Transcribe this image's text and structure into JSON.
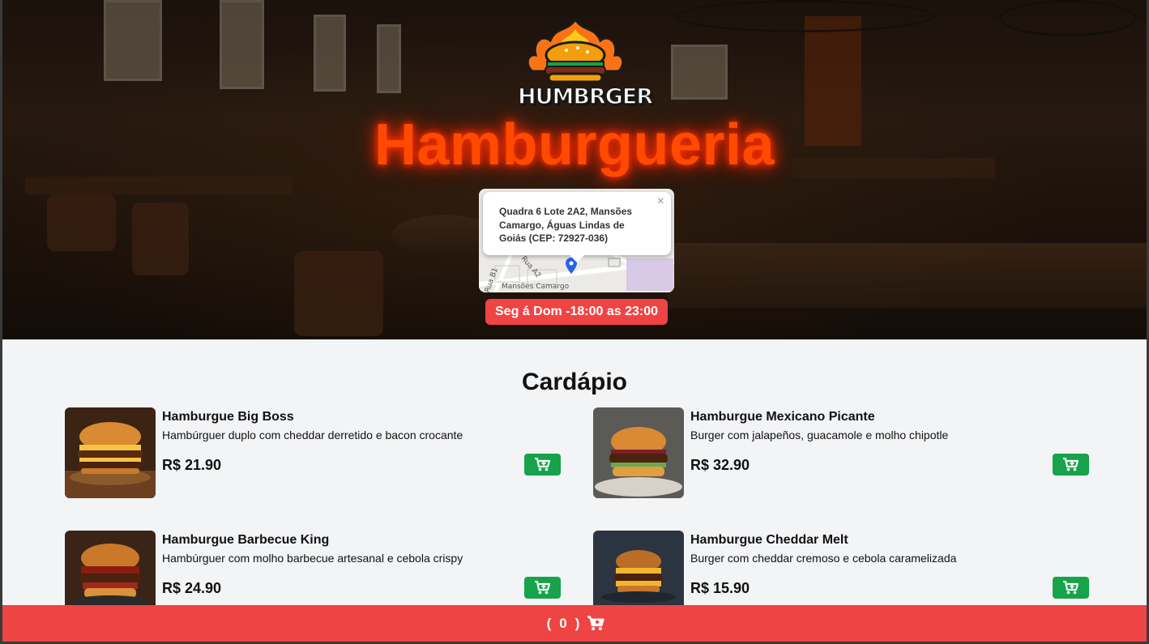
{
  "header": {
    "logo_text": "HUMBRGER",
    "title": "Hamburgueria",
    "map": {
      "address": "Quadra 6 Lote 2A2, Mansões Camargo, Águas Lindas de Goiás (CEP: 72927-036)",
      "close": "×",
      "road_label_1": "Rua A2",
      "road_label_2": "Rua B1",
      "area_label": "Mansões Camargo"
    },
    "hours": "Seg á Dom -18:00 as 23:00"
  },
  "menu": {
    "title": "Cardápio",
    "items": [
      {
        "name": "Hamburgue Big Boss",
        "description": "Hambúrguer duplo com cheddar derretido e bacon crocante",
        "price": "R$ 21.90"
      },
      {
        "name": "Hamburgue Mexicano Picante",
        "description": "Burger com jalapeños, guacamole e molho chipotle",
        "price": "R$ 32.90"
      },
      {
        "name": "Hamburgue Barbecue King",
        "description": "Hambúrguer com molho barbecue artesanal e cebola crispy",
        "price": "R$ 24.90"
      },
      {
        "name": "Hamburgue Cheddar Melt",
        "description": "Burger com cheddar cremoso e cebola caramelizada",
        "price": "R$ 15.90"
      }
    ]
  },
  "cart": {
    "open_paren": "(",
    "count": "0",
    "close_paren": ")",
    "icon": "cart-icon"
  },
  "colors": {
    "accent_red": "#ef4444",
    "add_green": "#16a34a",
    "title_neon": "#ff4a00"
  }
}
